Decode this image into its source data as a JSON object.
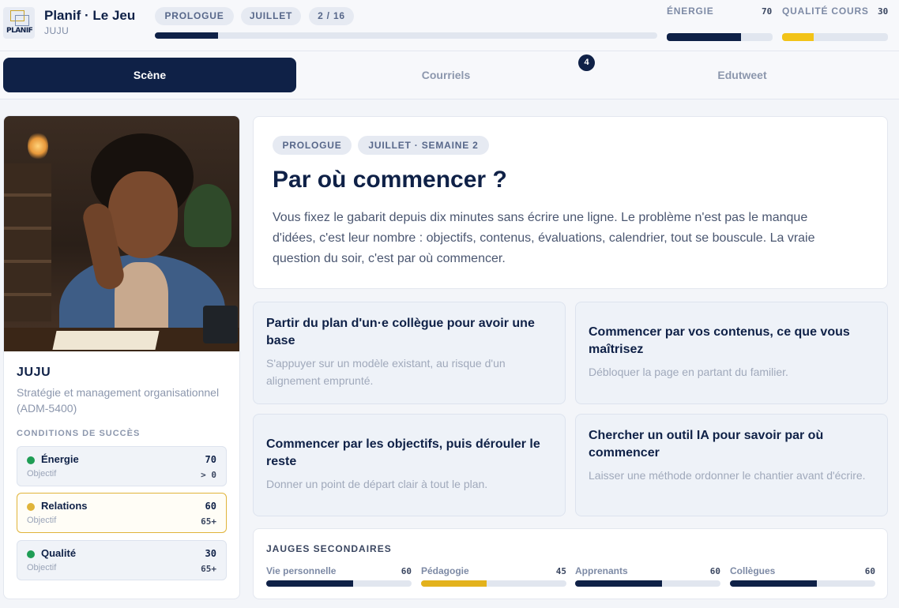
{
  "header": {
    "title": "Planif · Le Jeu",
    "subtitle": "JUJU",
    "logo_text": "PLANIF",
    "pills": [
      "PROLOGUE",
      "JUILLET",
      "2 / 16"
    ],
    "progress": 0.125,
    "stats": [
      {
        "label": "ÉNERGIE",
        "value": "70",
        "level": 0.7,
        "color": "#0f2147"
      },
      {
        "label": "QUALITÉ COURS",
        "value": "30",
        "level": 0.3,
        "color": "#f2c318"
      }
    ]
  },
  "tabs": [
    {
      "label": "Scène",
      "active": true
    },
    {
      "label": "Courriels",
      "active": false
    },
    {
      "label": "Edutweet",
      "active": false
    }
  ],
  "tab_badge": "4",
  "profile": {
    "name": "JUJU",
    "course": "Stratégie et management organisationnel (ADM-5400)",
    "conditions_title": "CONDITIONS DE SUCCÈS",
    "conditions": [
      {
        "name": "Énergie",
        "value": "70",
        "label": "Objectif",
        "target": "> 0",
        "dot_color": "#1f9d55",
        "warn": false
      },
      {
        "name": "Relations",
        "value": "60",
        "label": "Objectif",
        "target": "65+",
        "dot_color": "#e0b43a",
        "warn": true
      },
      {
        "name": "Qualité",
        "value": "30",
        "label": "Objectif",
        "target": "65+",
        "dot_color": "#1f9d55",
        "warn": false
      }
    ]
  },
  "scene": {
    "pills": [
      "PROLOGUE",
      "JUILLET · SEMAINE 2"
    ],
    "title": "Par où commencer ?",
    "description": "Vous fixez le gabarit depuis dix minutes sans écrire une ligne. Le problème n'est pas le manque d'idées, c'est leur nombre : objectifs, contenus, évaluations, calendrier, tout se bouscule. La vraie question du soir, c'est par où commencer."
  },
  "choices": [
    {
      "title": "Partir du plan d'un·e collègue pour avoir une base",
      "description": "S'appuyer sur un modèle existant, au risque d'un alignement emprunté."
    },
    {
      "title": "Commencer par vos contenus, ce que vous maîtrisez",
      "description": "Débloquer la page en partant du familier."
    },
    {
      "title": "Commencer par les objectifs, puis dérouler le reste",
      "description": "Donner un point de départ clair à tout le plan."
    },
    {
      "title": "Chercher un outil IA pour savoir par où commencer",
      "description": "Laisser une méthode ordonner le chantier avant d'écrire."
    }
  ],
  "gauges": {
    "title": "JAUGES SECONDAIRES",
    "items": [
      {
        "name": "Vie personnelle",
        "value": "60",
        "level": 0.6,
        "color": "#0f2147"
      },
      {
        "name": "Pédagogie",
        "value": "45",
        "level": 0.45,
        "color": "#e3b21c"
      },
      {
        "name": "Apprenants",
        "value": "60",
        "level": 0.6,
        "color": "#0f2147"
      },
      {
        "name": "Collègues",
        "value": "60",
        "level": 0.6,
        "color": "#0f2147"
      }
    ]
  }
}
